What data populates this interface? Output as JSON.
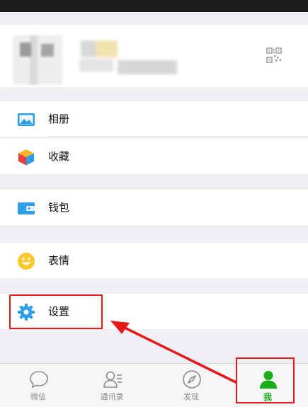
{
  "menu": {
    "album": "相册",
    "favorites": "收藏",
    "wallet": "钱包",
    "emoji": "表情",
    "settings": "设置"
  },
  "tabs": {
    "chats": "微信",
    "contacts": "通讯录",
    "discover": "发现",
    "me": "我"
  },
  "icons": {
    "album": "image-icon",
    "favorites": "cube-icon",
    "wallet": "wallet-icon",
    "emoji": "smiley-icon",
    "settings": "gear-icon",
    "profile": "qr-code-icon"
  },
  "colors": {
    "accent_green": "#1aad19",
    "icon_blue": "#2c9fe8",
    "highlight_red": "#e8181a",
    "background": "#efeff4"
  }
}
